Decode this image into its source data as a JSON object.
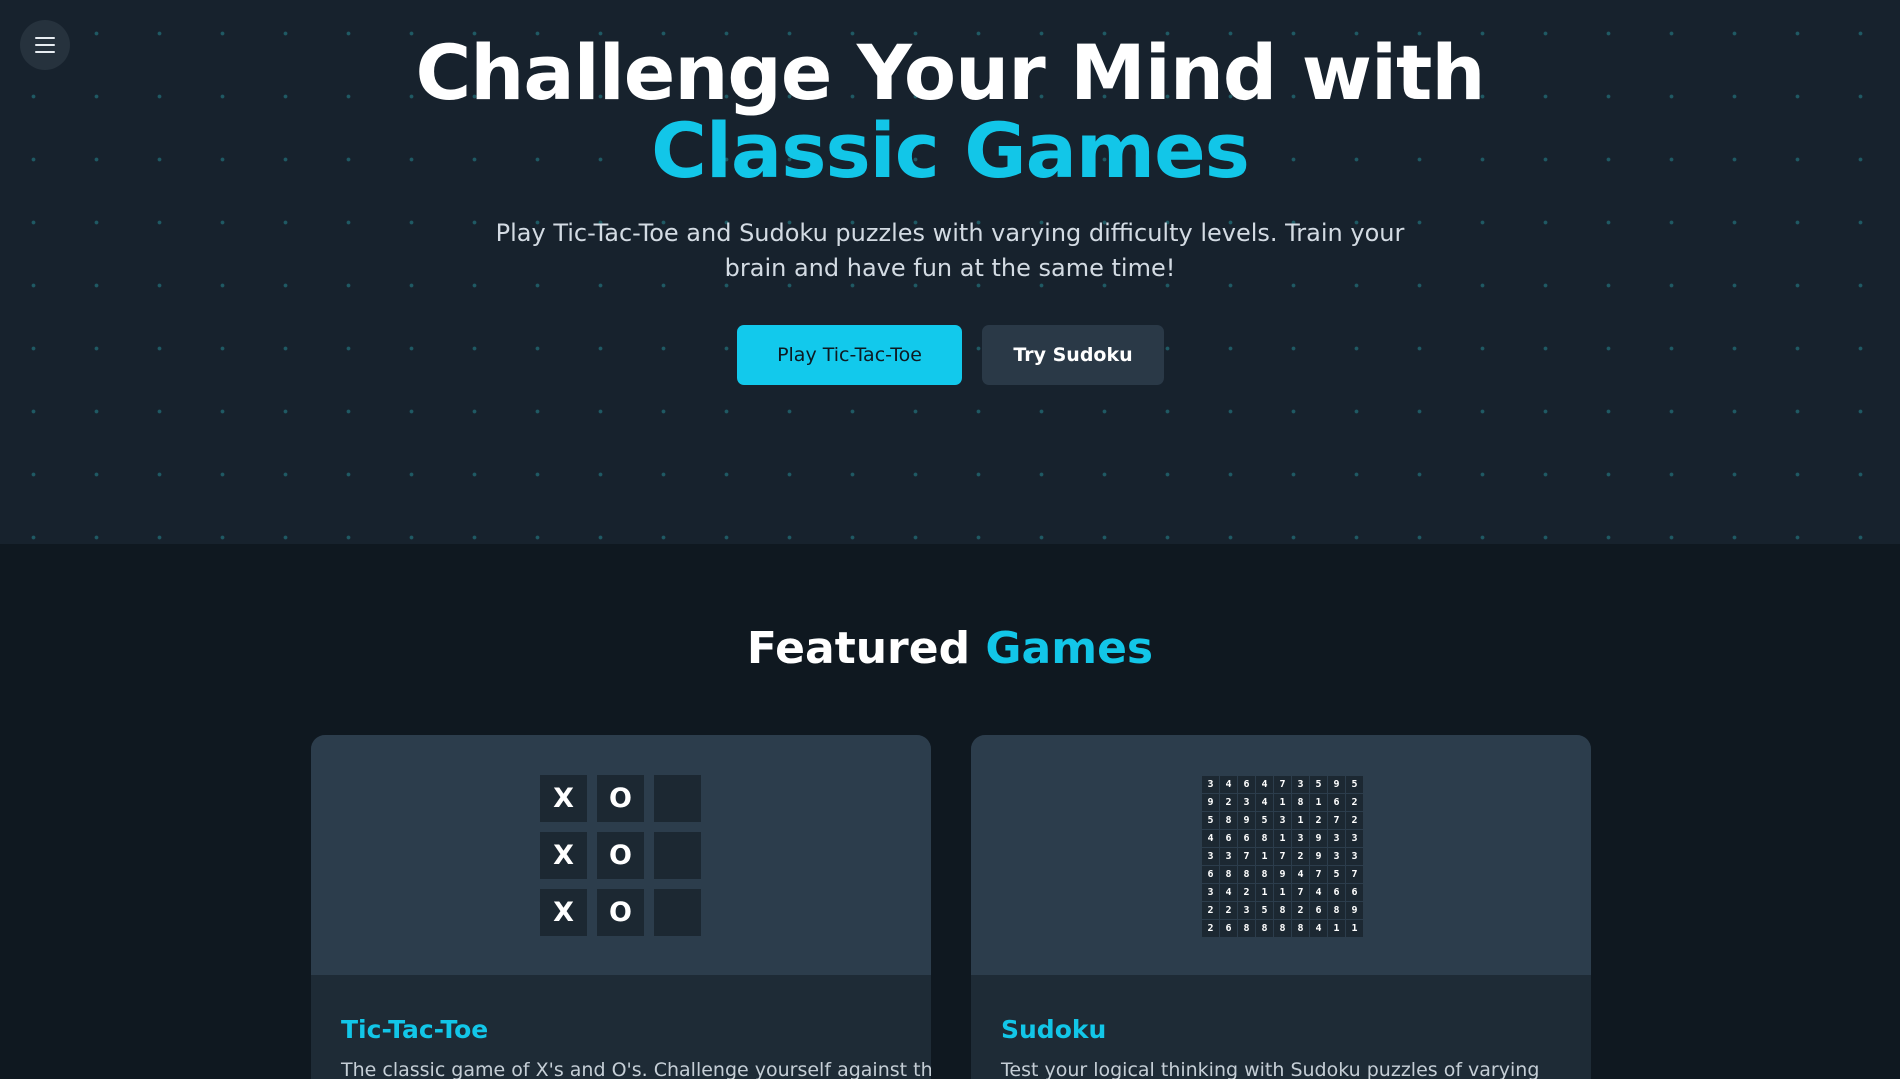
{
  "hero": {
    "title_line1": "Challenge Your Mind with",
    "title_line2": "Classic Games",
    "subtitle": "Play Tic-Tac-Toe and Sudoku puzzles with varying difficulty levels. Train your brain and have fun at the same time!",
    "primary_button": "Play Tic-Tac-Toe",
    "secondary_button": "Try Sudoku"
  },
  "menu_icon": "hamburger-menu-icon",
  "featured": {
    "title_main": "Featured",
    "title_accent": "Games"
  },
  "cards": [
    {
      "title": "Tic-Tac-Toe",
      "description": "The classic game of X's and O's. Challenge yourself against the",
      "board": [
        "X",
        "O",
        "",
        "X",
        "O",
        "",
        "X",
        "O",
        ""
      ]
    },
    {
      "title": "Sudoku",
      "description": "Test your logical thinking with Sudoku puzzles of varying",
      "board": [
        [
          "3",
          "4",
          "6",
          "4",
          "7",
          "3",
          "5",
          "9",
          "5"
        ],
        [
          "9",
          "2",
          "3",
          "4",
          "1",
          "8",
          "1",
          "6",
          "2"
        ],
        [
          "5",
          "8",
          "9",
          "5",
          "3",
          "1",
          "2",
          "7",
          "2"
        ],
        [
          "4",
          "6",
          "6",
          "8",
          "1",
          "3",
          "9",
          "3",
          "3"
        ],
        [
          "3",
          "3",
          "7",
          "1",
          "7",
          "2",
          "9",
          "3",
          "3"
        ],
        [
          "6",
          "8",
          "8",
          "8",
          "9",
          "4",
          "7",
          "5",
          "7"
        ],
        [
          "3",
          "4",
          "2",
          "1",
          "1",
          "7",
          "4",
          "6",
          "6"
        ],
        [
          "2",
          "2",
          "3",
          "5",
          "8",
          "2",
          "6",
          "8",
          "9"
        ],
        [
          "2",
          "6",
          "8",
          "8",
          "8",
          "8",
          "4",
          "1",
          "1"
        ]
      ]
    }
  ],
  "colors": {
    "accent": "#12c6e8",
    "hero_bg": "#17222d",
    "page_bg": "#0f1820",
    "card_preview": "#2c3d4c"
  }
}
